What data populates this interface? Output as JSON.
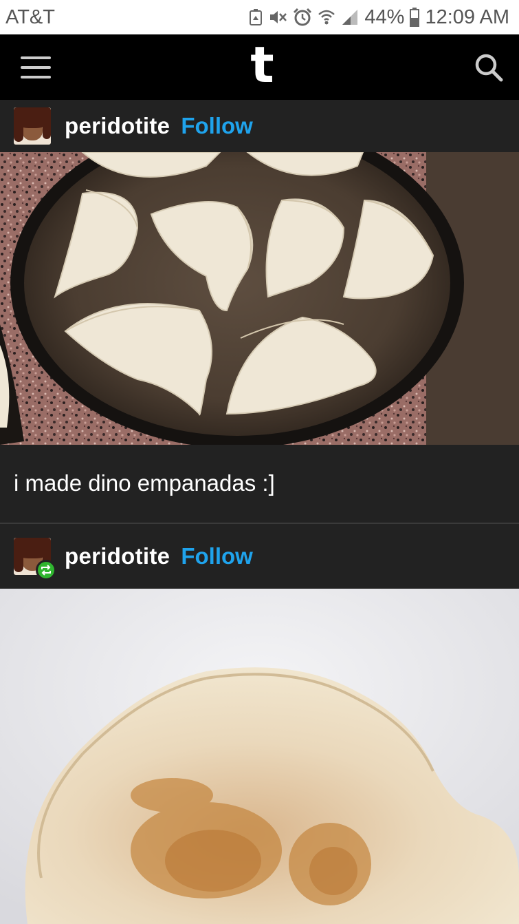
{
  "status_bar": {
    "carrier": "AT&T",
    "battery": "44%",
    "time": "12:09 AM"
  },
  "app_bar": {
    "logo": "t"
  },
  "posts": [
    {
      "username": "peridotite",
      "follow_label": "Follow",
      "caption": "i made dino empanadas :]"
    },
    {
      "username": "peridotite",
      "follow_label": "Follow"
    }
  ],
  "colors": {
    "accent": "#1fa3ec",
    "reblog": "#2fb52f",
    "background": "#222222",
    "topbar": "#000000"
  }
}
